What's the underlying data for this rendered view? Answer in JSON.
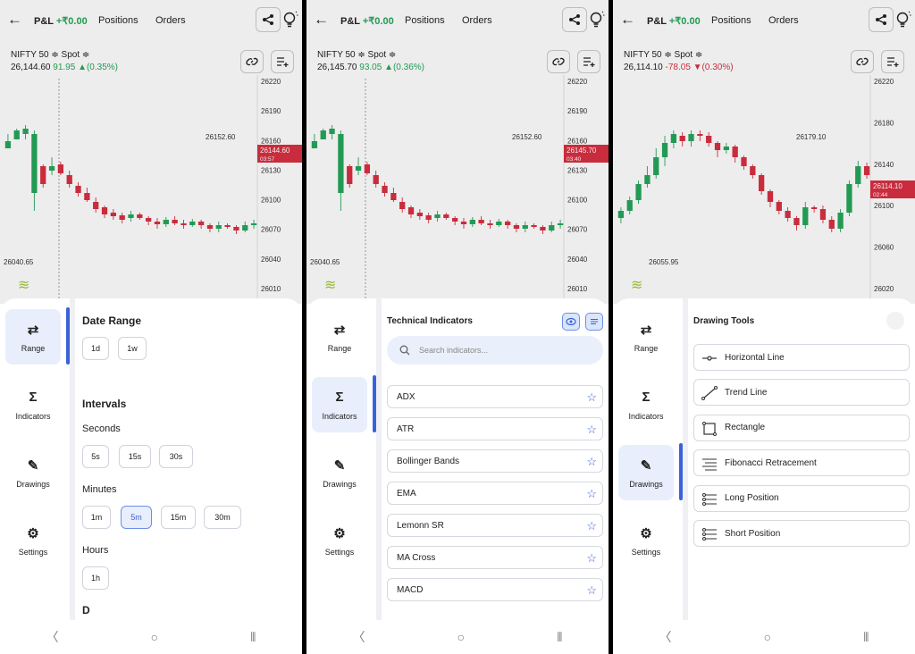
{
  "colors": {
    "up": "#26a65b",
    "down": "#d93042",
    "accent": "#3a63d8",
    "price_tag": "#d93042"
  },
  "topbar": {
    "pnl_label": "P&L",
    "pnl_value": "+₹0.00",
    "tab_positions": "Positions",
    "tab_orders": "Orders"
  },
  "side_labels": {
    "range": "Range",
    "indicators": "Indicators",
    "drawings": "Drawings",
    "settings": "Settings"
  },
  "screens": [
    {
      "symbol": "NIFTY 50 ≑ Spot ≑",
      "ltp": "26,144.60",
      "change": "91.95 ▲(0.35%)",
      "direction": "up",
      "y_axis": [
        "26220",
        "26190",
        "26160",
        "26130",
        "26100",
        "26070",
        "26040",
        "26010"
      ],
      "high_label": "26152.60",
      "low_label": "26040.65",
      "tag_price": "26144.60",
      "tag_time": "03:57"
    },
    {
      "symbol": "NIFTY 50 ≑ Spot ≑",
      "ltp": "26,145.70",
      "change": "93.05 ▲(0.36%)",
      "direction": "up",
      "y_axis": [
        "26220",
        "26190",
        "26160",
        "26130",
        "26100",
        "26070",
        "26040",
        "26010"
      ],
      "high_label": "26152.60",
      "low_label": "26040.65",
      "tag_price": "26145.70",
      "tag_time": "03:40"
    },
    {
      "symbol": "NIFTY 50 ≑ Spot ≑",
      "ltp": "26,114.10",
      "change": "-78.05 ▼(0.30%)",
      "direction": "down",
      "y_axis": [
        "26220",
        "26180",
        "26140",
        "26100",
        "26060",
        "26020"
      ],
      "high_label": "26179.10",
      "low_label": "26055.95",
      "tag_price": "26114.10",
      "tag_time": "02:44"
    }
  ],
  "range_panel": {
    "date_range_title": "Date Range",
    "date_chips": [
      "1d",
      "1w"
    ],
    "intervals_title": "Intervals",
    "seconds_label": "Seconds",
    "seconds": [
      "5s",
      "15s",
      "30s"
    ],
    "minutes_label": "Minutes",
    "minutes": [
      "1m",
      "5m",
      "15m",
      "30m"
    ],
    "selected_minute": "5m",
    "hours_label": "Hours",
    "hours": [
      "1h"
    ],
    "cut_label": "D"
  },
  "indicators_panel": {
    "title": "Technical Indicators",
    "search_placeholder": "Search indicators...",
    "items": [
      "ADX",
      "ATR",
      "Bollinger Bands",
      "EMA",
      "Lemonn SR",
      "MA Cross",
      "MACD"
    ]
  },
  "drawings_panel": {
    "title": "Drawing Tools",
    "tools": [
      "Horizontal Line",
      "Trend Line",
      "Rectangle",
      "Fibonacci Retracement",
      "Long Position",
      "Short Position"
    ]
  }
}
